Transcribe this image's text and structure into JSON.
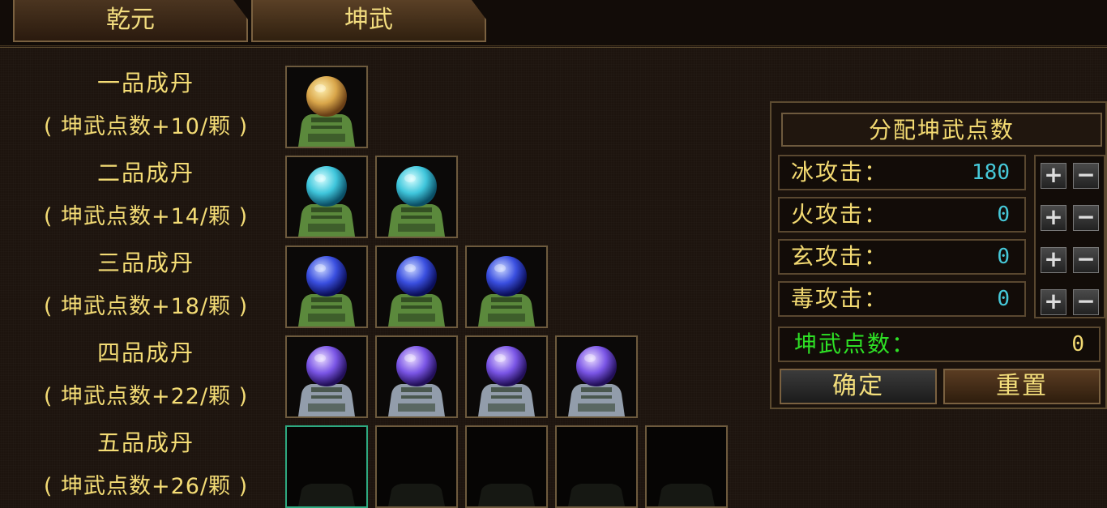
{
  "tabs": [
    {
      "label": "乾元"
    },
    {
      "label": "坤武"
    }
  ],
  "tiers": [
    {
      "name": "一品成丹",
      "desc": "( 坤武点数+10/颗 )",
      "slots": 1,
      "orb": "gold",
      "empty": false
    },
    {
      "name": "二品成丹",
      "desc": "( 坤武点数+14/颗 )",
      "slots": 2,
      "orb": "cyan",
      "empty": false
    },
    {
      "name": "三品成丹",
      "desc": "( 坤武点数+18/颗 )",
      "slots": 3,
      "orb": "blue",
      "empty": false
    },
    {
      "name": "四品成丹",
      "desc": "( 坤武点数+22/颗 )",
      "slots": 4,
      "orb": "purple",
      "empty": false
    },
    {
      "name": "五品成丹",
      "desc": "( 坤武点数+26/颗 )",
      "slots": 5,
      "orb": "none",
      "empty": true
    }
  ],
  "panel": {
    "title": "分配坤武点数",
    "rows": [
      {
        "label": "冰攻击：",
        "value": "180"
      },
      {
        "label": "火攻击：",
        "value": "0"
      },
      {
        "label": "玄攻击：",
        "value": "0"
      },
      {
        "label": "毒攻击：",
        "value": "0"
      }
    ],
    "plus": "+",
    "minus": "−",
    "points_label": "坤武点数：",
    "points_value": "0",
    "confirm": "确定",
    "reset": "重置"
  },
  "colors": {
    "gold": "#d7a44a",
    "cyan": "#3fc6dc",
    "blue": "#3a4fe0",
    "purple": "#7a55e6",
    "accent_text": "#f4dc75",
    "points_label": "#2ee025",
    "value_text": "#46c9d9"
  }
}
